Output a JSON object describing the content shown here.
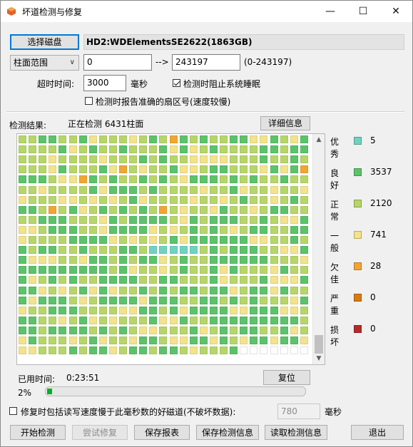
{
  "window": {
    "title": "坏道检测与修复",
    "minimize_glyph": "—",
    "maximize_glyph": "☐",
    "close_glyph": "✕"
  },
  "disk": {
    "select_button": "选择磁盘",
    "name": "HD2:WDElementsSE2622(1863GB)"
  },
  "range": {
    "mode_label": "柱面范围",
    "start": "0",
    "arrow": "-->",
    "end": "243197",
    "hint": "(0-243197)"
  },
  "timeout": {
    "label": "超时时间:",
    "value": "3000",
    "unit": "毫秒",
    "prevent_sleep_label": "检测时阻止系统睡眠",
    "prevent_sleep_checked": true,
    "report_sector_label": "检测时报告准确的扇区号(速度较慢)",
    "report_sector_checked": false
  },
  "result": {
    "label": "检测结果:",
    "status": "正在检测 6431柱面",
    "detail_button": "详细信息"
  },
  "legend": [
    {
      "label": "优秀",
      "color": "#6fd3c0",
      "count": "5"
    },
    {
      "label": "良好",
      "color": "#5cc36a",
      "count": "3537"
    },
    {
      "label": "正常",
      "color": "#b7d66a",
      "count": "2120"
    },
    {
      "label": "一般",
      "color": "#f2e38c",
      "count": "741"
    },
    {
      "label": "欠佳",
      "color": "#f2a531",
      "count": "28"
    },
    {
      "label": "严重",
      "color": "#d97a14",
      "count": "0"
    },
    {
      "label": "损坏",
      "color": "#b52b2b",
      "count": "0"
    }
  ],
  "elapsed": {
    "label": "已用时间:",
    "value": "0:23:51",
    "reset_button": "复位"
  },
  "progress": {
    "text": "2%",
    "fraction": 0.02
  },
  "repair": {
    "label": "修复时包括读写速度慢于此毫秒数的好磁道(不破坏数据):",
    "checked": false,
    "value": "780",
    "unit": "毫秒"
  },
  "buttons": {
    "start": "开始检测",
    "try_repair": "尝试修复",
    "save_report": "保存报表",
    "save_info": "保存检测信息",
    "load_info": "读取检测信息",
    "exit": "退出"
  },
  "scroll": {
    "up_glyph": "▲",
    "down_glyph": "▼"
  }
}
